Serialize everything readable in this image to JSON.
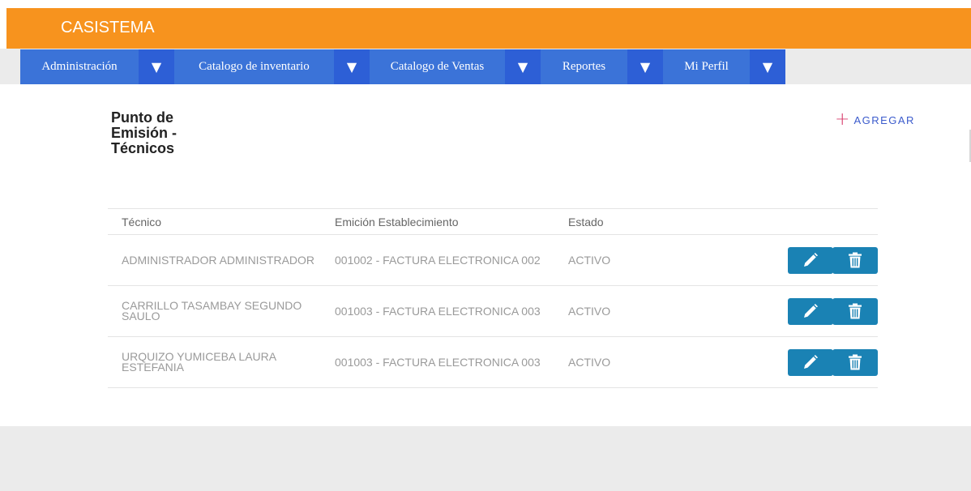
{
  "app": {
    "brand": "CASISTEMA"
  },
  "nav": {
    "items": [
      {
        "label": "Administración",
        "arrow": "▼",
        "width": 146
      },
      {
        "label": "Catalogo de inventario",
        "arrow": "▼",
        "width": 197
      },
      {
        "label": "Catalogo de Ventas",
        "arrow": "▼",
        "width": 167
      },
      {
        "label": "Reportes",
        "arrow": "▼",
        "width": 107
      },
      {
        "label": "Mi Perfil",
        "arrow": "▼",
        "width": 107
      }
    ]
  },
  "page": {
    "title": "Punto de Emisión - Técnicos",
    "add_label": "AGREGAR",
    "add_icon": "plus-icon"
  },
  "table": {
    "headers": {
      "tecnico": "Técnico",
      "emicion": "Emición Establecimiento",
      "estado": "Estado"
    },
    "rows": [
      {
        "tecnico": "ADMINISTRADOR ADMINISTRADOR",
        "emicion": "001002 - FACTURA ELECTRONICA 002",
        "estado": "ACTIVO"
      },
      {
        "tecnico": "CARRILLO TASAMBAY SEGUNDO SAULO",
        "emicion": "001003 - FACTURA ELECTRONICA 003",
        "estado": "ACTIVO"
      },
      {
        "tecnico": "URQUIZO YUMICEBA LAURA ESTEFANIA",
        "emicion": "001003 - FACTURA ELECTRONICA 003",
        "estado": "ACTIVO"
      }
    ]
  },
  "colors": {
    "header_orange": "#f7931e",
    "nav_blue": "#3b73d8",
    "nav_arrow_blue": "#2d5fd6",
    "action_blue": "#1a82b4",
    "add_plus": "#d63a6a",
    "add_text": "#3b5bcc"
  }
}
